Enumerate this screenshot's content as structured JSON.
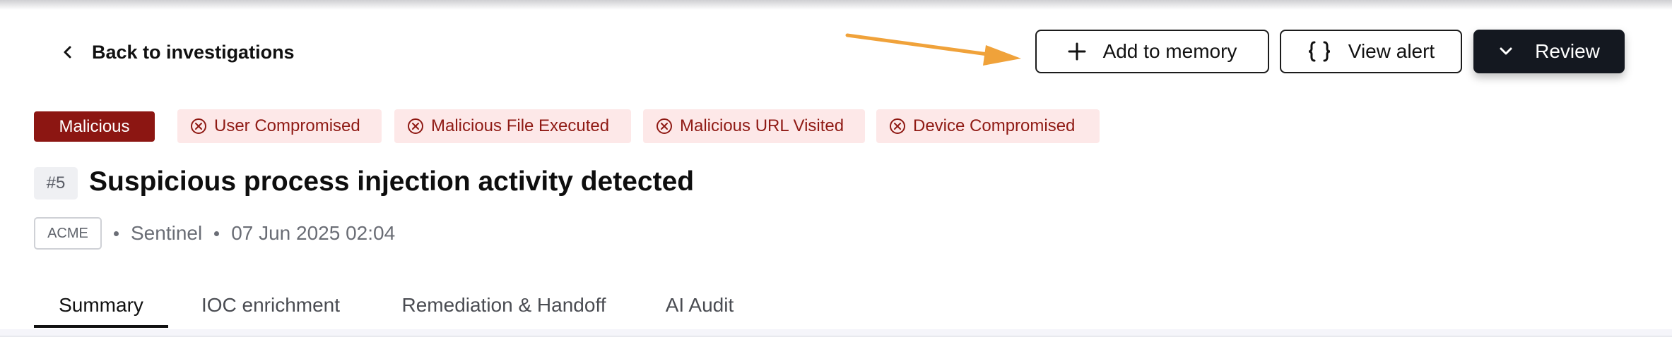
{
  "header": {
    "back_label": "Back to investigations",
    "buttons": {
      "add_memory": "Add to memory",
      "view_alert": "View alert",
      "review": "Review"
    },
    "annotation": {
      "type": "arrow",
      "color": "#F0A23A",
      "points_to": "add-to-memory-button"
    }
  },
  "icons": {
    "back": "chevron-left-icon",
    "add": "plus-icon",
    "view_alert": "braces-icon",
    "review": "chevron-down-icon",
    "tag": "x-circle-icon"
  },
  "verdict": {
    "label": "Malicious",
    "color": "#8C1612"
  },
  "tags": [
    {
      "label": "User Compromised"
    },
    {
      "label": "Malicious File Executed"
    },
    {
      "label": "Malicious URL Visited"
    },
    {
      "label": "Device Compromised"
    }
  ],
  "investigation": {
    "number": "#5",
    "title": "Suspicious process injection activity detected",
    "tenant": "ACME",
    "source": "Sentinel",
    "timestamp": "07 Jun 2025 02:04"
  },
  "tabs": [
    {
      "label": "Summary",
      "active": true
    },
    {
      "label": "IOC enrichment",
      "active": false
    },
    {
      "label": "Remediation & Handoff",
      "active": false
    },
    {
      "label": "AI Audit",
      "active": false
    }
  ],
  "colors": {
    "tag_bg": "#FDE8E8",
    "tag_text": "#8F1A14",
    "primary_button": "#141820"
  }
}
